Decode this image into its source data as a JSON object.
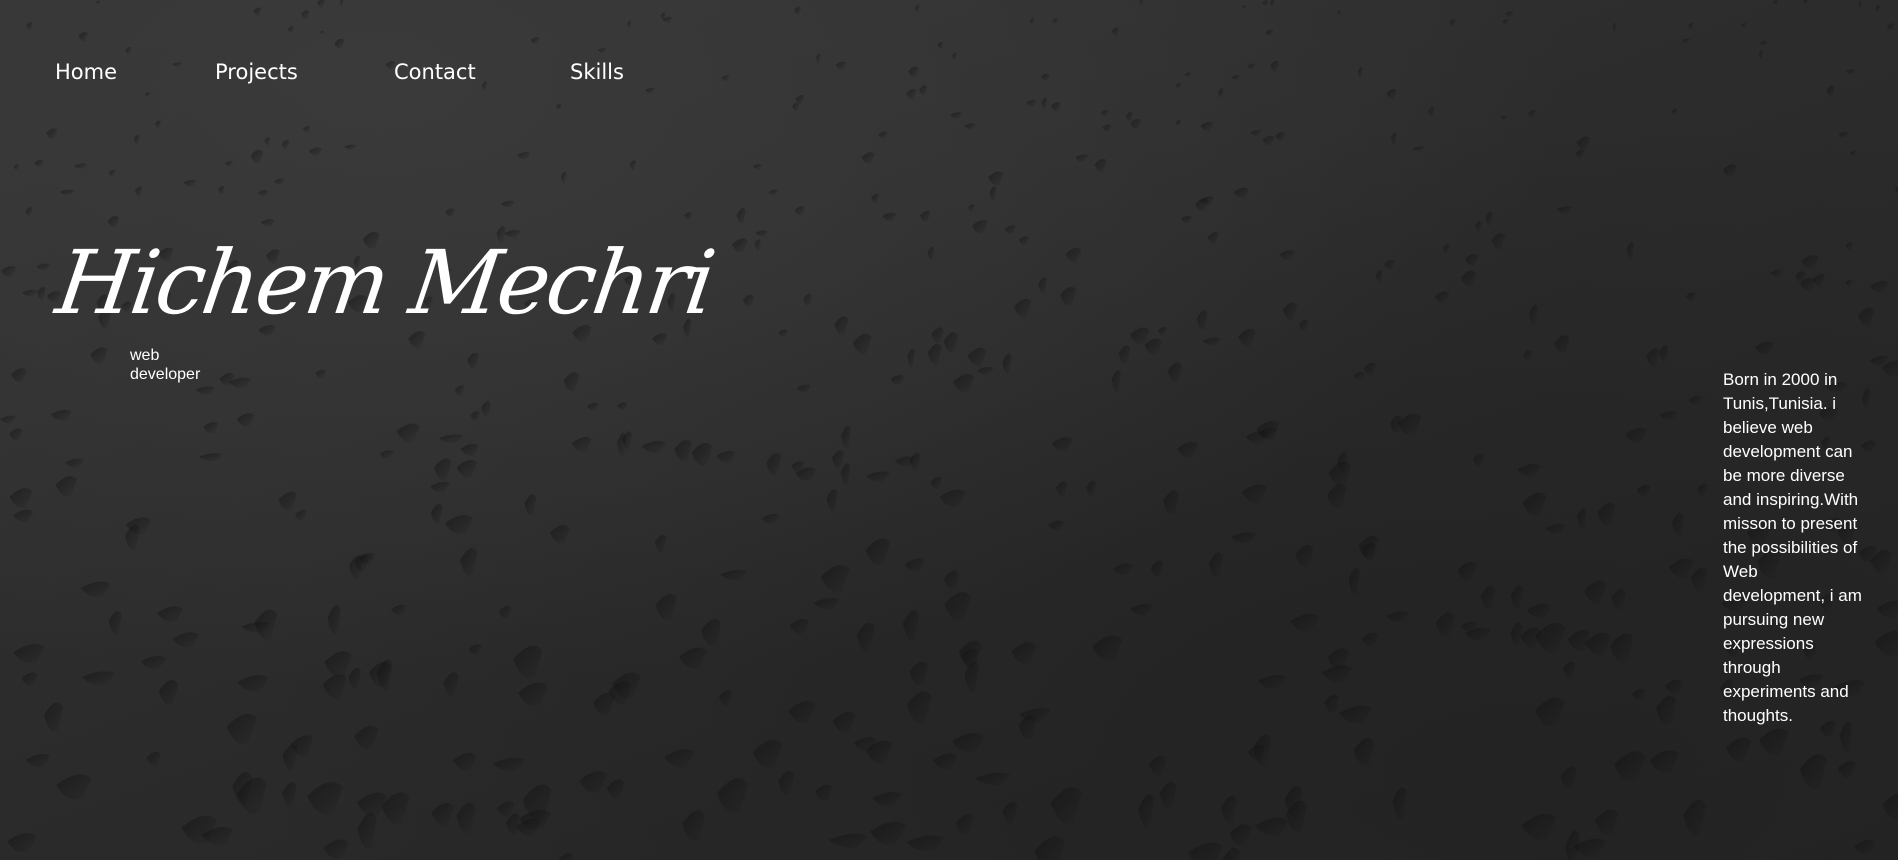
{
  "nav": {
    "items": [
      {
        "label": "Home"
      },
      {
        "label": "Projects"
      },
      {
        "label": "Contact"
      },
      {
        "label": "Skills"
      }
    ]
  },
  "hero": {
    "name": "Hichem Mechri",
    "role": "web developer"
  },
  "bio": {
    "text": "Born in 2000 in Tunis,Tunisia. i believe web development can be more diverse and inspiring.With misson to present the possibilities of Web development, i am pursuing new expressions through experiments and thoughts."
  },
  "colors": {
    "background": "#2a2a2a",
    "text": "#ffffff"
  }
}
